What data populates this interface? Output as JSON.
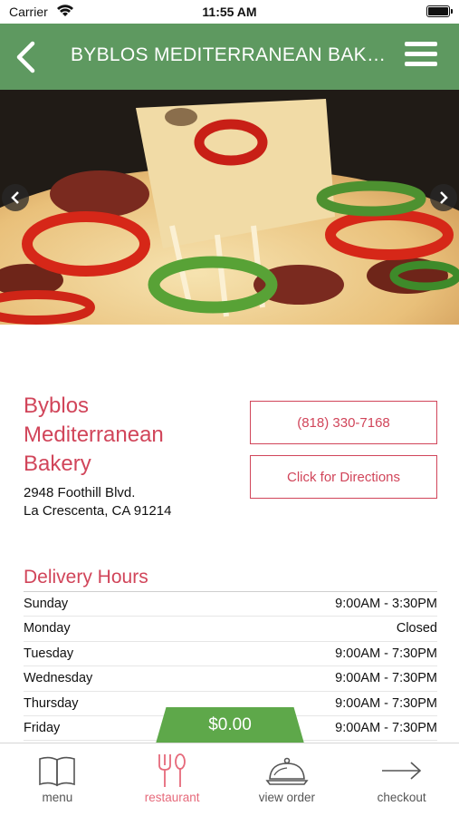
{
  "status_bar": {
    "carrier": "Carrier",
    "time": "11:55 AM"
  },
  "nav": {
    "title": "BYBLOS MEDITERRANEAN BAKERY"
  },
  "restaurant": {
    "name": "Byblos Mediterranean Bakery",
    "address_line1": "2948 Foothill Blvd.",
    "address_line2": "La Crescenta, CA 91214",
    "phone_label": "(818) 330-7168",
    "directions_label": "Click for Directions"
  },
  "delivery_hours": {
    "heading": "Delivery Hours",
    "rows": [
      {
        "day": "Sunday",
        "hours": "9:00AM - 3:30PM"
      },
      {
        "day": "Monday",
        "hours": "Closed"
      },
      {
        "day": "Tuesday",
        "hours": "9:00AM - 7:30PM"
      },
      {
        "day": "Wednesday",
        "hours": "9:00AM - 7:30PM"
      },
      {
        "day": "Thursday",
        "hours": "9:00AM - 7:30PM"
      },
      {
        "day": "Friday",
        "hours": "9:00AM - 7:30PM"
      }
    ]
  },
  "cart_total": "$0.00",
  "tabs": [
    {
      "label": "menu",
      "icon": "book-icon",
      "active": false
    },
    {
      "label": "restaurant",
      "icon": "fork-spoon-icon",
      "active": true
    },
    {
      "label": "view order",
      "icon": "cloche-icon",
      "active": false
    },
    {
      "label": "checkout",
      "icon": "arrow-right-icon",
      "active": false
    }
  ],
  "colors": {
    "nav_green": "#5e9960",
    "accent_red": "#d1455a",
    "total_green": "#5ea84a",
    "active_tab": "#e66a7b"
  }
}
